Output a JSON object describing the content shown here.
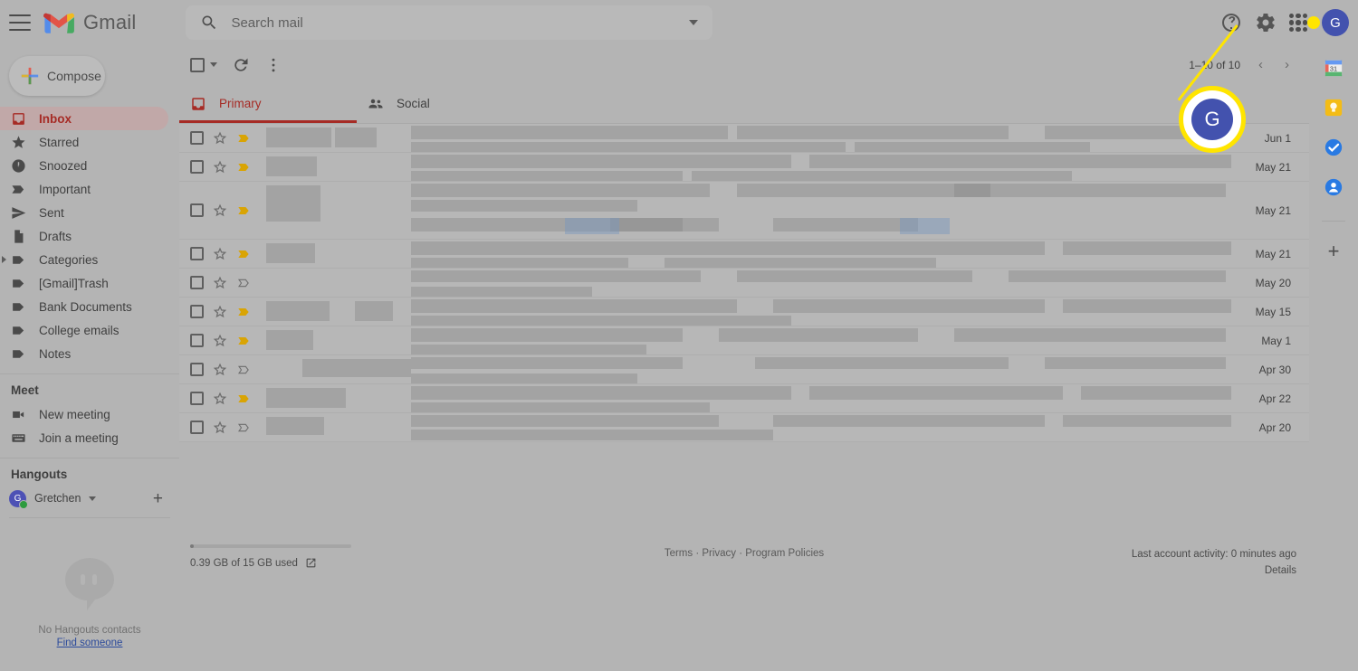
{
  "header": {
    "menu_icon": "hamburger-menu-icon",
    "logo_text": "Gmail",
    "search_placeholder": "Search mail",
    "search_value": "",
    "search_icon": "search-icon",
    "options_icon": "chevron-down-icon",
    "help_icon": "help-icon",
    "settings_icon": "gear-icon",
    "apps_icon": "apps-grid-icon",
    "avatar_letter": "G"
  },
  "sidebar": {
    "compose_label": "Compose",
    "items": [
      {
        "label": "Inbox",
        "icon": "inbox-icon",
        "active": true
      },
      {
        "label": "Starred",
        "icon": "star-icon",
        "active": false
      },
      {
        "label": "Snoozed",
        "icon": "clock-icon",
        "active": false
      },
      {
        "label": "Important",
        "icon": "important-icon",
        "active": false
      },
      {
        "label": "Sent",
        "icon": "send-icon",
        "active": false
      },
      {
        "label": "Drafts",
        "icon": "draft-icon",
        "active": false
      },
      {
        "label": "Categories",
        "icon": "label-icon",
        "active": false
      },
      {
        "label": "[Gmail]Trash",
        "icon": "label-icon",
        "active": false
      },
      {
        "label": "Bank Documents",
        "icon": "label-icon",
        "active": false
      },
      {
        "label": "College emails",
        "icon": "label-icon",
        "active": false
      },
      {
        "label": "Notes",
        "icon": "label-icon",
        "active": false
      }
    ],
    "meet": {
      "title": "Meet",
      "items": [
        {
          "label": "New meeting",
          "icon": "video-camera-icon"
        },
        {
          "label": "Join a meeting",
          "icon": "keyboard-icon"
        }
      ]
    },
    "hangouts": {
      "title": "Hangouts",
      "user_name": "Gretchen",
      "user_initial": "G",
      "add_icon": "plus-icon",
      "empty_text": "No Hangouts contacts",
      "find_link": "Find someone"
    }
  },
  "toolbar": {
    "select_all_icon": "checkbox-icon",
    "refresh_icon": "refresh-icon",
    "more_icon": "more-vertical-icon",
    "page_count": "1–10 of 10",
    "prev_icon": "‹",
    "next_icon": "›"
  },
  "tabs": [
    {
      "label": "Primary",
      "icon": "inbox-tab-icon",
      "active": true
    },
    {
      "label": "Social",
      "icon": "people-icon",
      "active": false
    }
  ],
  "emails": [
    {
      "date": "Jun 1",
      "starred": false,
      "important": true,
      "tall": false
    },
    {
      "date": "May 21",
      "starred": false,
      "important": true,
      "tall": false
    },
    {
      "date": "May 21",
      "starred": false,
      "important": true,
      "tall": true
    },
    {
      "date": "May 21",
      "starred": false,
      "important": true,
      "tall": false
    },
    {
      "date": "May 20",
      "starred": false,
      "important": false,
      "tall": false
    },
    {
      "date": "May 15",
      "starred": false,
      "important": true,
      "tall": false
    },
    {
      "date": "May 1",
      "starred": false,
      "important": true,
      "tall": false
    },
    {
      "date": "Apr 30",
      "starred": false,
      "important": false,
      "tall": false
    },
    {
      "date": "Apr 22",
      "starred": false,
      "important": true,
      "tall": false
    },
    {
      "date": "Apr 20",
      "starred": false,
      "important": false,
      "tall": false
    }
  ],
  "footer": {
    "storage_text": "0.39 GB of 15 GB used",
    "storage_icon": "external-link-icon",
    "links": "Terms · Privacy · Program Policies",
    "activity": "Last account activity: 0 minutes ago",
    "details": "Details"
  },
  "rail": {
    "items": [
      {
        "icon": "google-calendar-icon"
      },
      {
        "icon": "google-keep-icon"
      },
      {
        "icon": "google-tasks-icon"
      },
      {
        "icon": "google-contacts-icon"
      }
    ],
    "add_icon": "plus-icon"
  },
  "callout": {
    "avatar_letter": "G",
    "highlight_color": "#ffe500"
  }
}
